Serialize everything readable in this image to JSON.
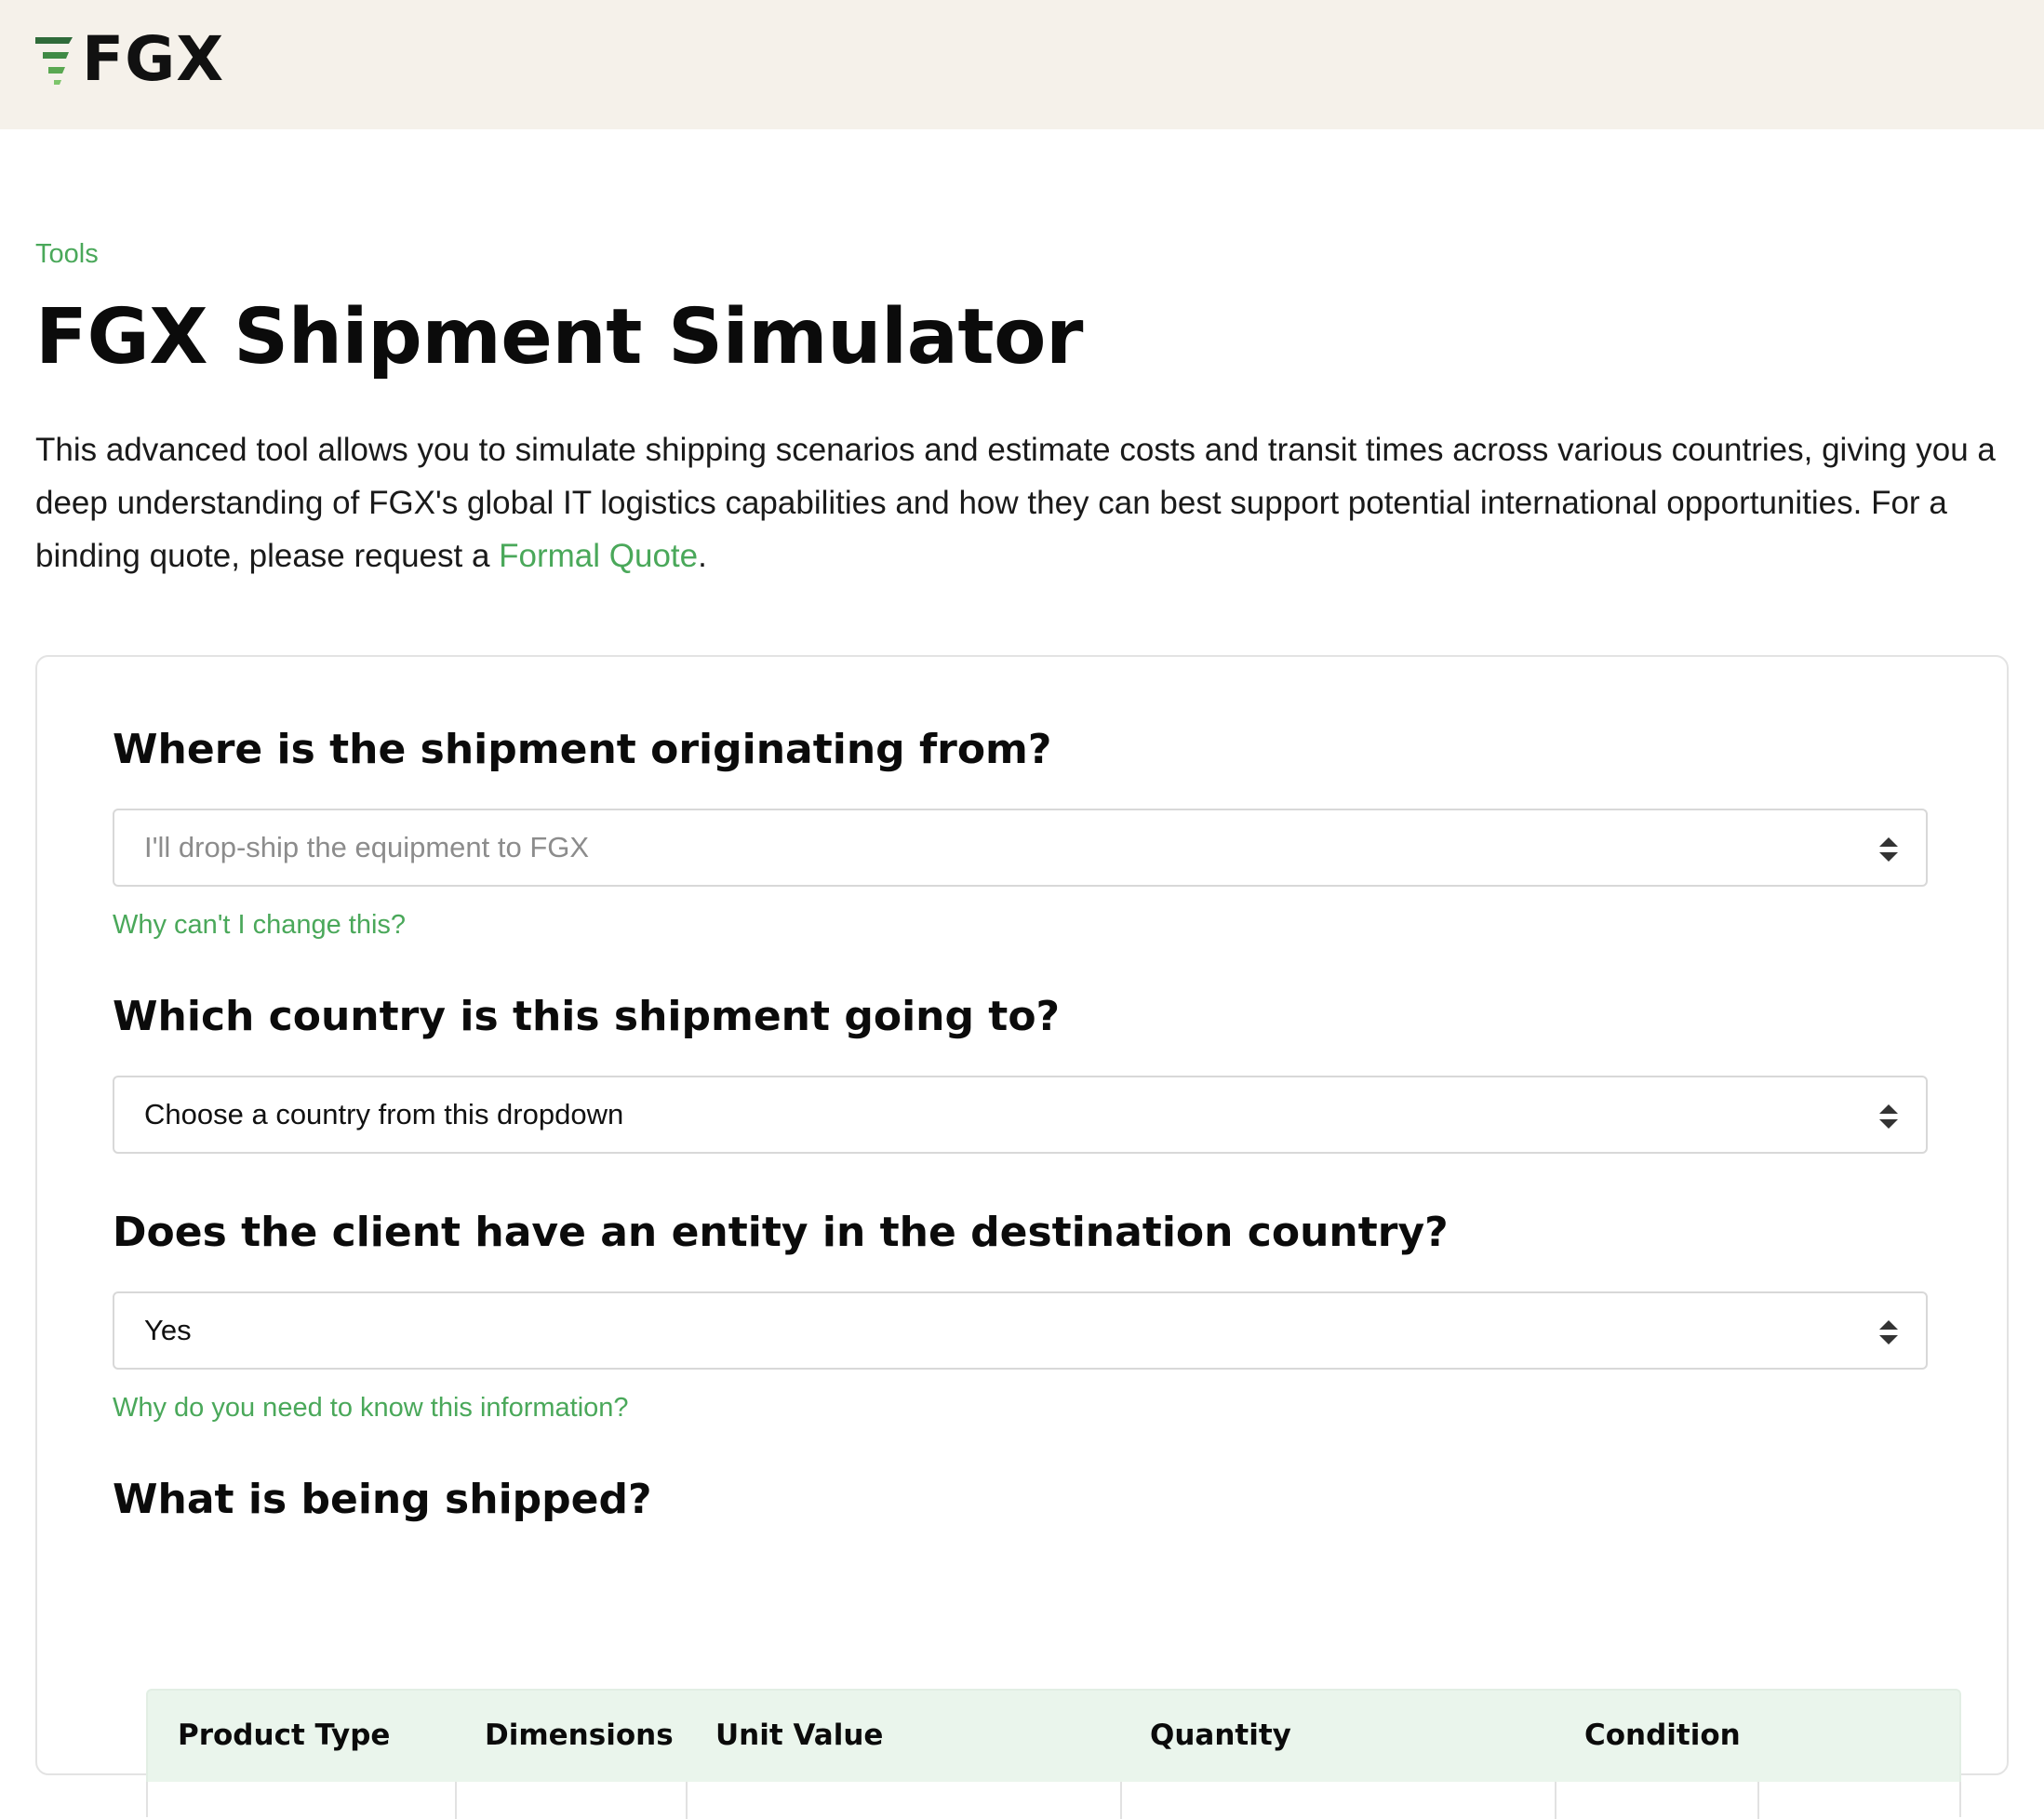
{
  "header": {
    "logo_text": "FGX",
    "logo_icon": "fgx-stripes-logo",
    "background": "#f5f1ea"
  },
  "breadcrumb": "Tools",
  "page_title": "FGX Shipment Simulator",
  "intro": {
    "text": "This advanced tool allows you to simulate shipping scenarios and estimate costs and transit times across various countries, giving you a deep understanding of FGX's global IT logistics capabilities and how they can best support potential international opportunities. For a binding quote, please request a ",
    "link_label": "Formal Quote",
    "end": "."
  },
  "form": {
    "origin": {
      "question": "Where is the shipment originating from?",
      "value": "I'll drop-ship the equipment to FGX",
      "disabled": true,
      "help_link": "Why can't I change this?"
    },
    "destination": {
      "question": "Which country is this shipment going to?",
      "value": "Choose a country from this dropdown"
    },
    "entity": {
      "question": "Does the client have an entity in the destination country?",
      "value": "Yes",
      "help_link": "Why do you need to know this information?"
    },
    "shipped": {
      "question": "What is being shipped?",
      "columns": [
        "Product Type",
        "Dimensions",
        "Unit Value",
        "Quantity",
        "Condition"
      ]
    }
  },
  "colors": {
    "accent": "#4aa85a",
    "table_header_bg": "#eaf5ec",
    "logo_green_dark": "#2f6b3a",
    "logo_green_light": "#7dc56b"
  }
}
